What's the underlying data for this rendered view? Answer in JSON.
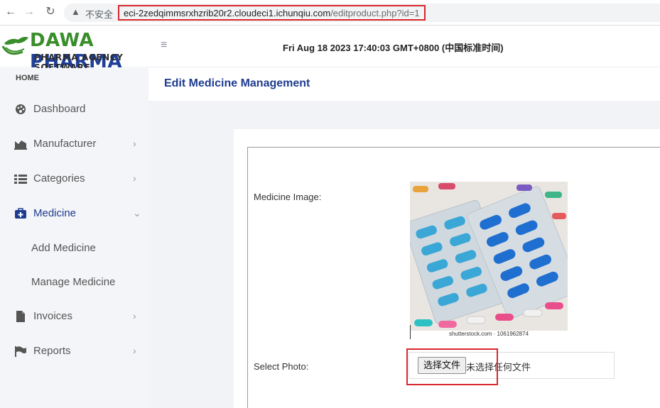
{
  "browser": {
    "insecure_label": "不安全",
    "url_host": "eci-2zedqimmsrxhzrib20r2.cloudeci1.ichunqiu.com",
    "url_path": "/editproduct.php?id=1"
  },
  "header": {
    "logo_title_green": "DAWA",
    "logo_title_blue": "PHARMA",
    "logo_subtitle": "PHARMA AGENCY SOFTWARE",
    "datetime": "Fri Aug 18 2023 17:40:03 GMT+0800 (中国标准时间)"
  },
  "sidebar": {
    "section_label": "HOME",
    "items": [
      {
        "label": "Dashboard",
        "icon": "palette-icon",
        "chevron": ""
      },
      {
        "label": "Manufacturer",
        "icon": "chart-area-icon",
        "chevron": "›"
      },
      {
        "label": "Categories",
        "icon": "list-icon",
        "chevron": "›"
      },
      {
        "label": "Medicine",
        "icon": "medkit-icon",
        "chevron": "⌄"
      },
      {
        "label": "Invoices",
        "icon": "file-icon",
        "chevron": "›"
      },
      {
        "label": "Reports",
        "icon": "flag-icon",
        "chevron": "›"
      }
    ],
    "sub_items": [
      {
        "label": "Add Medicine"
      },
      {
        "label": "Manage Medicine"
      }
    ]
  },
  "main": {
    "page_title": "Edit Medicine Management",
    "medicine_image_label": "Medicine Image:",
    "image_caption": "shutterstock.com · 1061962874",
    "select_photo_label": "Select Photo:",
    "file_button_label": "选择文件",
    "file_status": "未选择任何文件"
  },
  "colors": {
    "brand_blue": "#1e3c8f",
    "brand_green": "#3a8d2b",
    "highlight_red": "#d9272e"
  }
}
